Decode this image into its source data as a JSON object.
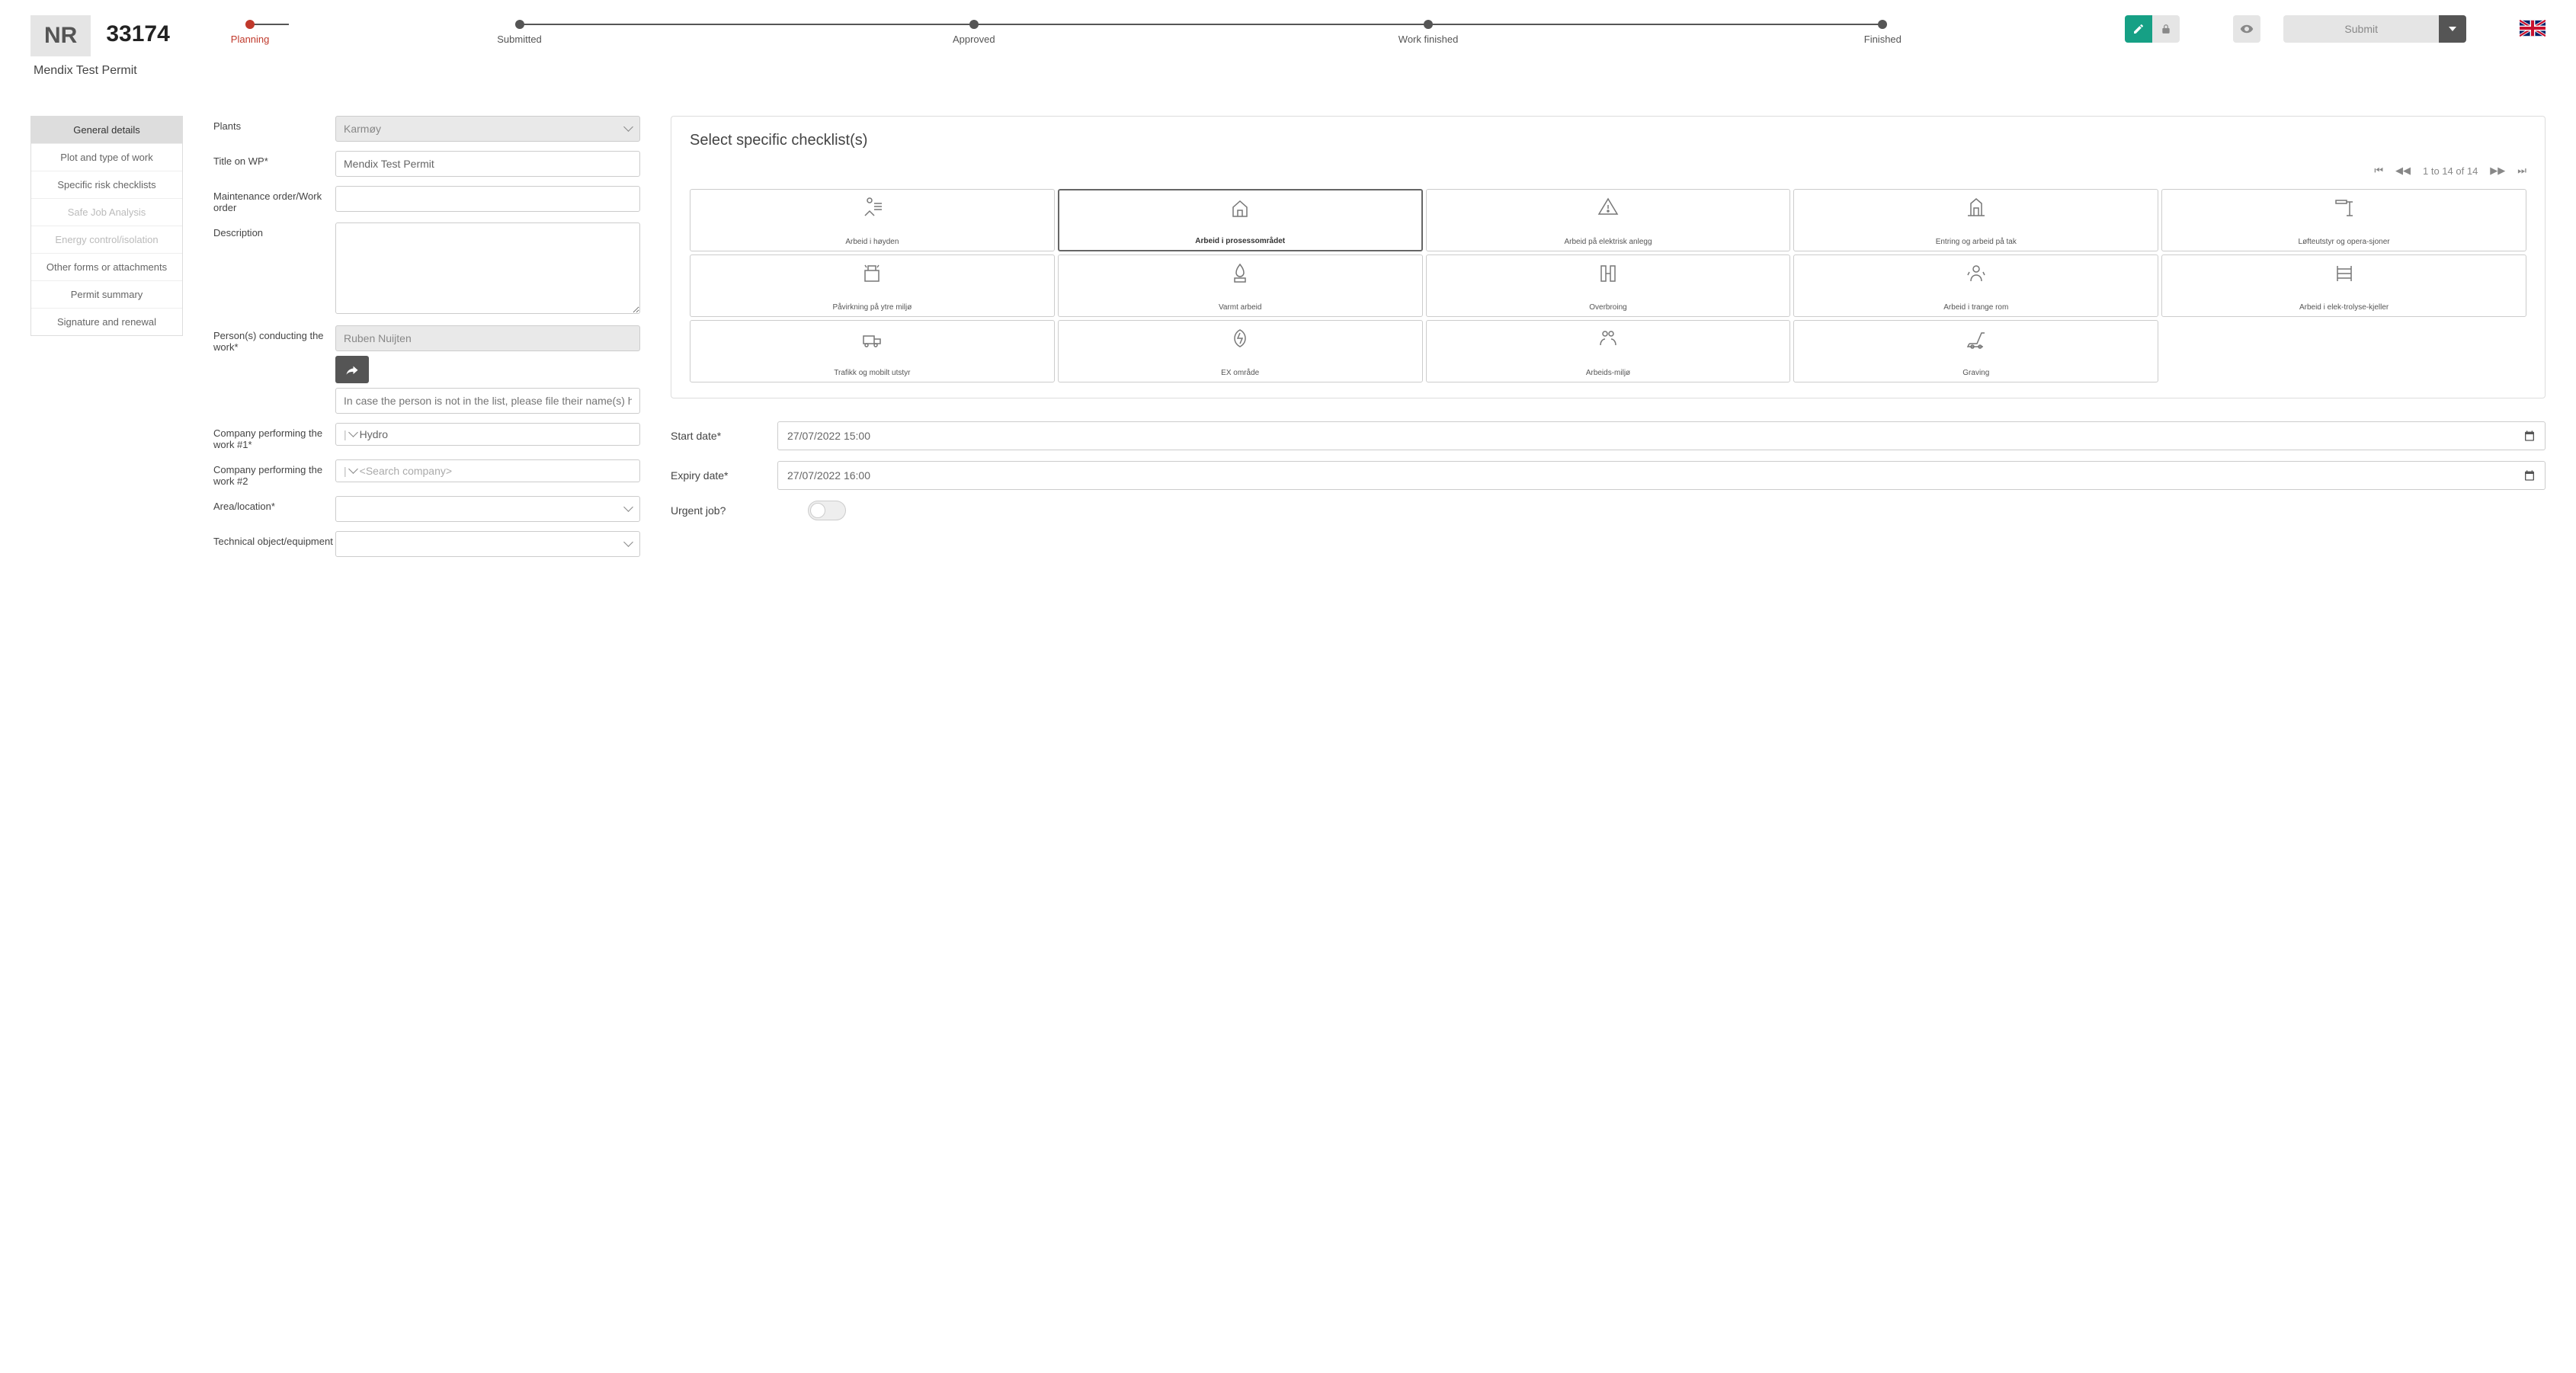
{
  "header": {
    "nr_label": "NR",
    "permit_number": "33174",
    "subtitle": "Mendix Test Permit",
    "steps": [
      "Planning",
      "Submitted",
      "Approved",
      "Work finished",
      "Finished"
    ],
    "active_step_index": 0,
    "submit_label": "Submit"
  },
  "sidebar": {
    "items": [
      {
        "label": "General details",
        "state": "active"
      },
      {
        "label": "Plot and type of work",
        "state": "normal"
      },
      {
        "label": "Specific risk checklists",
        "state": "normal"
      },
      {
        "label": "Safe Job Analysis",
        "state": "disabled"
      },
      {
        "label": "Energy control/isolation",
        "state": "disabled"
      },
      {
        "label": "Other forms or attachments",
        "state": "normal"
      },
      {
        "label": "Permit summary",
        "state": "normal"
      },
      {
        "label": "Signature and renewal",
        "state": "normal"
      }
    ]
  },
  "form": {
    "plants_label": "Plants",
    "plants_value": "Karmøy",
    "title_label": "Title on WP*",
    "title_value": "Mendix Test Permit",
    "maint_label": "Maintenance order/Work order",
    "maint_value": "",
    "desc_label": "Description",
    "desc_value": "",
    "persons_label": "Person(s) conducting the work*",
    "persons_value": "Ruben Nuijten",
    "persons_placeholder": "In case the person is not in the list, please file their name(s) here",
    "company1_label": "Company performing the work #1*",
    "company1_value": "Hydro",
    "company2_label": "Company performing the work #2",
    "company2_placeholder": "<Search company>",
    "area_label": "Area/location*",
    "tech_label": "Technical object/equipment"
  },
  "checklist": {
    "title": "Select specific checklist(s)",
    "pager_text": "1 to 14 of 14",
    "items": [
      {
        "label": "Arbeid i høyden",
        "selected": false
      },
      {
        "label": "Arbeid i prosessområdet",
        "selected": true
      },
      {
        "label": "Arbeid på elektrisk anlegg",
        "selected": false
      },
      {
        "label": "Entring og arbeid på tak",
        "selected": false
      },
      {
        "label": "Løfteutstyr og opera-sjoner",
        "selected": false
      },
      {
        "label": "Påvirkning på ytre miljø",
        "selected": false
      },
      {
        "label": "Varmt arbeid",
        "selected": false
      },
      {
        "label": "Overbroing",
        "selected": false
      },
      {
        "label": "Arbeid i trange rom",
        "selected": false
      },
      {
        "label": "Arbeid i elek-trolyse-kjeller",
        "selected": false
      },
      {
        "label": "Trafikk og mobilt utstyr",
        "selected": false
      },
      {
        "label": "EX område",
        "selected": false
      },
      {
        "label": "Arbeids-miljø",
        "selected": false
      },
      {
        "label": "Graving",
        "selected": false
      }
    ]
  },
  "dates": {
    "start_label": "Start date*",
    "start_value": "27/07/2022 15:00",
    "expiry_label": "Expiry date*",
    "expiry_value": "27/07/2022 16:00",
    "urgent_label": "Urgent job?"
  }
}
